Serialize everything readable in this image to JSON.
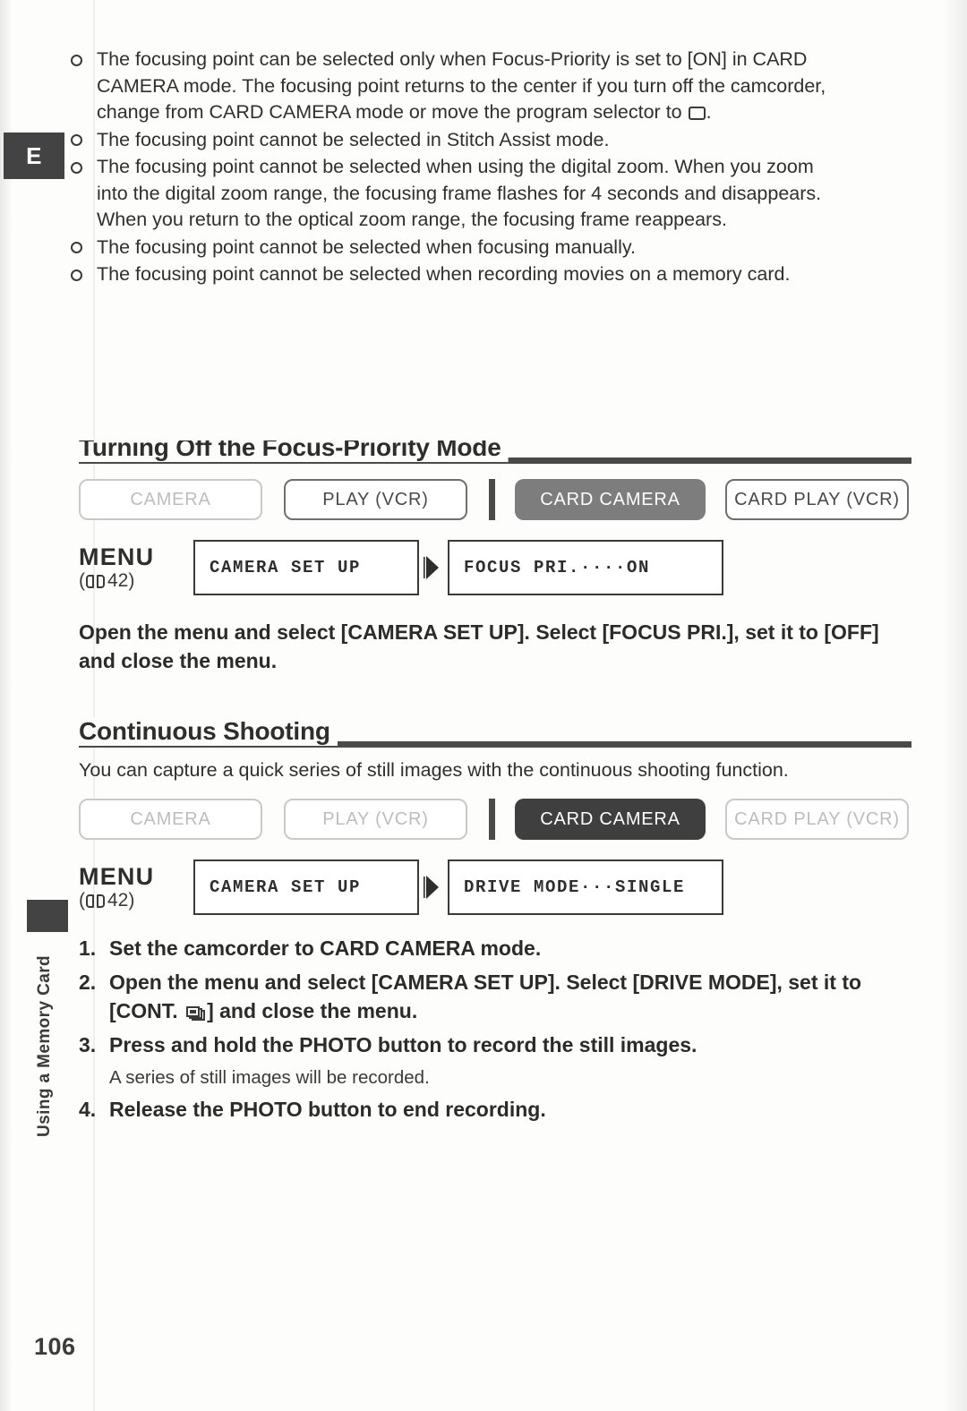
{
  "page": {
    "number": "106",
    "language_tab": "E",
    "side_tab_label": "Using a Memory Card"
  },
  "notes": [
    {
      "text_before_icon": "The focusing point can be selected only when Focus-Priority is set to [ON] in CARD CAMERA mode. The focusing point returns to the center if you turn off the camcorder, change from CARD CAMERA mode or move the program selector to ",
      "icon": "program-selector-icon",
      "text_after_icon": "."
    },
    {
      "text_before_icon": "The focusing point cannot be selected in Stitch Assist mode.",
      "icon": null,
      "text_after_icon": ""
    },
    {
      "text_before_icon": "The focusing point cannot be selected when using the digital zoom. When you zoom into the digital zoom range, the focusing frame flashes for 4 seconds and disappears. When you return to the optical zoom range, the focusing frame reappears.",
      "icon": null,
      "text_after_icon": ""
    },
    {
      "text_before_icon": "The focusing point cannot be selected when focusing manually.",
      "icon": null,
      "text_after_icon": ""
    },
    {
      "text_before_icon": "The focusing point cannot be selected when recording movies on a memory card.",
      "icon": null,
      "text_after_icon": ""
    }
  ],
  "section1": {
    "heading": "Turning Off the Focus-Priority Mode",
    "modes": [
      {
        "label": "CAMERA",
        "state": "faded"
      },
      {
        "label": "PLAY (VCR)",
        "state": "outline"
      },
      {
        "label": "CARD CAMERA",
        "state": "active"
      },
      {
        "label": "CARD PLAY (VCR)",
        "state": "outline"
      }
    ],
    "menu": {
      "label": "MENU",
      "ref_open": "(",
      "ref_page": "42",
      "ref_close": ")",
      "path_item": "CAMERA SET UP",
      "setting_item": "FOCUS PRI.····ON"
    },
    "instruction": "Open the menu and select [CAMERA SET UP]. Select [FOCUS PRI.], set it to [OFF] and close the menu."
  },
  "section2": {
    "heading": "Continuous Shooting",
    "intro": "You can capture a quick series of still images with the continuous shooting function.",
    "modes": [
      {
        "label": "CAMERA",
        "state": "faded"
      },
      {
        "label": "PLAY (VCR)",
        "state": "faded"
      },
      {
        "label": "CARD CAMERA",
        "state": "active-dark"
      },
      {
        "label": "CARD PLAY (VCR)",
        "state": "faded"
      }
    ],
    "menu": {
      "label": "MENU",
      "ref_open": "(",
      "ref_page": "42",
      "ref_close": ")",
      "path_item": "CAMERA SET UP",
      "setting_item": "DRIVE MODE···SINGLE"
    },
    "steps": [
      {
        "num": "1.",
        "text_before_icon": "Set the camcorder to CARD CAMERA mode.",
        "icon": null,
        "text_after_icon": "",
        "note": null
      },
      {
        "num": "2.",
        "text_before_icon": "Open the menu and select [CAMERA SET UP]. Select [DRIVE MODE], set it to [CONT. ",
        "icon": "continuous-shooting-icon",
        "text_after_icon": "] and close the menu.",
        "note": null
      },
      {
        "num": "3.",
        "text_before_icon": "Press and hold the PHOTO button to record the still images.",
        "icon": null,
        "text_after_icon": "",
        "note": "A series of still images will be recorded."
      },
      {
        "num": "4.",
        "text_before_icon": "Release the PHOTO button to end recording.",
        "icon": null,
        "text_after_icon": "",
        "note": null
      }
    ]
  },
  "colors": {
    "ink": "#2b2b2b",
    "rule": "#4a4a4a",
    "active_pill": "#7d7d7d",
    "active_pill_dark": "#3f3f3f",
    "faded": "#bdbdbd"
  }
}
